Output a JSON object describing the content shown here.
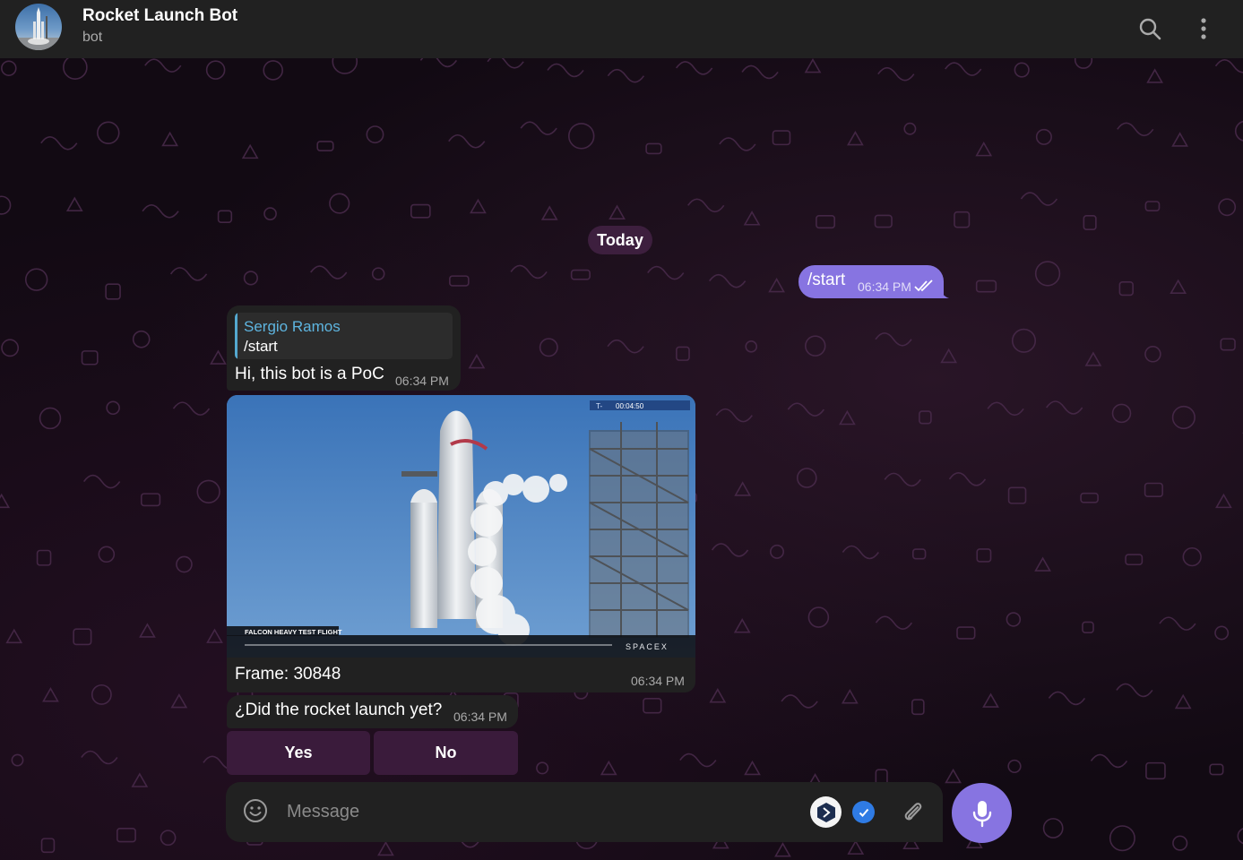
{
  "header": {
    "title": "Rocket Launch Bot",
    "subtitle": "bot",
    "search_icon": "search-icon",
    "menu_icon": "more-vertical-icon"
  },
  "chat": {
    "date_label": "Today",
    "outgoing": {
      "text": "/start",
      "time": "06:34 PM",
      "status_icon": "double-check-icon"
    },
    "incoming_reply": {
      "reply_to_name": "Sergio Ramos",
      "reply_to_text": "/start",
      "text": "Hi, this bot is a PoC",
      "time": "06:34 PM"
    },
    "photo_message": {
      "overlay_timer_prefix": "T-",
      "overlay_timer": "00:04:50",
      "overlay_title": "FALCON HEAVY TEST FLIGHT",
      "overlay_brand": "SPACEX",
      "caption": "Frame: 30848",
      "time": "06:34 PM"
    },
    "question": {
      "text": "¿Did the rocket launch yet?",
      "time": "06:34 PM"
    },
    "keyboard": {
      "yes_label": "Yes",
      "no_label": "No"
    }
  },
  "composer": {
    "placeholder": "Message",
    "emoji_icon": "smile-icon",
    "attach_icon": "paperclip-icon",
    "mic_icon": "microphone-icon"
  },
  "colors": {
    "accent": "#8774e1",
    "header_bg": "#212121",
    "bubble_in": "#212121",
    "reply_name": "#5eb5e0",
    "keyboard_btn": "#3a1b3b"
  }
}
